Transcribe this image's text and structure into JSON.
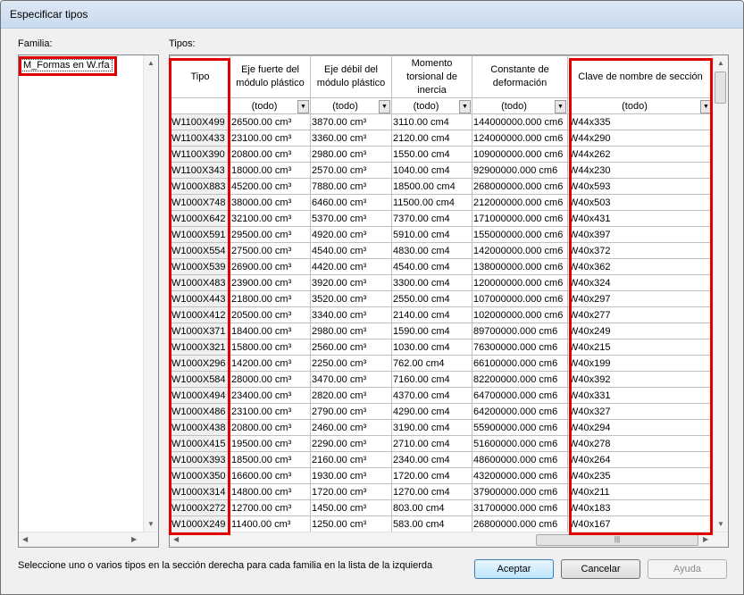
{
  "window_title": "Especificar tipos",
  "familia_label": "Familia:",
  "tipos_label": "Tipos:",
  "family_items": [
    "M_Formas en W.rfa"
  ],
  "columns": [
    "Tipo",
    "Eje fuerte del módulo plástico",
    "Eje débil del módulo plástico",
    "Momento torsional de inercia",
    "Constante de deformación",
    "Clave de nombre de sección"
  ],
  "filter_value": "(todo)",
  "rows": [
    [
      "W1100X499",
      "26500.00 cm³",
      "3870.00 cm³",
      "3110.00 cm4",
      "144000000.000 cm6",
      "W44x335"
    ],
    [
      "W1100X433",
      "23100.00 cm³",
      "3360.00 cm³",
      "2120.00 cm4",
      "124000000.000 cm6",
      "W44x290"
    ],
    [
      "W1100X390",
      "20800.00 cm³",
      "2980.00 cm³",
      "1550.00 cm4",
      "109000000.000 cm6",
      "W44x262"
    ],
    [
      "W1100X343",
      "18000.00 cm³",
      "2570.00 cm³",
      "1040.00 cm4",
      "92900000.000 cm6",
      "W44x230"
    ],
    [
      "W1000X883",
      "45200.00 cm³",
      "7880.00 cm³",
      "18500.00 cm4",
      "268000000.000 cm6",
      "W40x593"
    ],
    [
      "W1000X748",
      "38000.00 cm³",
      "6460.00 cm³",
      "11500.00 cm4",
      "212000000.000 cm6",
      "W40x503"
    ],
    [
      "W1000X642",
      "32100.00 cm³",
      "5370.00 cm³",
      "7370.00 cm4",
      "171000000.000 cm6",
      "W40x431"
    ],
    [
      "W1000X591",
      "29500.00 cm³",
      "4920.00 cm³",
      "5910.00 cm4",
      "155000000.000 cm6",
      "W40x397"
    ],
    [
      "W1000X554",
      "27500.00 cm³",
      "4540.00 cm³",
      "4830.00 cm4",
      "142000000.000 cm6",
      "W40x372"
    ],
    [
      "W1000X539",
      "26900.00 cm³",
      "4420.00 cm³",
      "4540.00 cm4",
      "138000000.000 cm6",
      "W40x362"
    ],
    [
      "W1000X483",
      "23900.00 cm³",
      "3920.00 cm³",
      "3300.00 cm4",
      "120000000.000 cm6",
      "W40x324"
    ],
    [
      "W1000X443",
      "21800.00 cm³",
      "3520.00 cm³",
      "2550.00 cm4",
      "107000000.000 cm6",
      "W40x297"
    ],
    [
      "W1000X412",
      "20500.00 cm³",
      "3340.00 cm³",
      "2140.00 cm4",
      "102000000.000 cm6",
      "W40x277"
    ],
    [
      "W1000X371",
      "18400.00 cm³",
      "2980.00 cm³",
      "1590.00 cm4",
      "89700000.000 cm6",
      "W40x249"
    ],
    [
      "W1000X321",
      "15800.00 cm³",
      "2560.00 cm³",
      "1030.00 cm4",
      "76300000.000 cm6",
      "W40x215"
    ],
    [
      "W1000X296",
      "14200.00 cm³",
      "2250.00 cm³",
      "762.00 cm4",
      "66100000.000 cm6",
      "W40x199"
    ],
    [
      "W1000X584",
      "28000.00 cm³",
      "3470.00 cm³",
      "7160.00 cm4",
      "82200000.000 cm6",
      "W40x392"
    ],
    [
      "W1000X494",
      "23400.00 cm³",
      "2820.00 cm³",
      "4370.00 cm4",
      "64700000.000 cm6",
      "W40x331"
    ],
    [
      "W1000X486",
      "23100.00 cm³",
      "2790.00 cm³",
      "4290.00 cm4",
      "64200000.000 cm6",
      "W40x327"
    ],
    [
      "W1000X438",
      "20800.00 cm³",
      "2460.00 cm³",
      "3190.00 cm4",
      "55900000.000 cm6",
      "W40x294"
    ],
    [
      "W1000X415",
      "19500.00 cm³",
      "2290.00 cm³",
      "2710.00 cm4",
      "51600000.000 cm6",
      "W40x278"
    ],
    [
      "W1000X393",
      "18500.00 cm³",
      "2160.00 cm³",
      "2340.00 cm4",
      "48600000.000 cm6",
      "W40x264"
    ],
    [
      "W1000X350",
      "16600.00 cm³",
      "1930.00 cm³",
      "1720.00 cm4",
      "43200000.000 cm6",
      "W40x235"
    ],
    [
      "W1000X314",
      "14800.00 cm³",
      "1720.00 cm³",
      "1270.00 cm4",
      "37900000.000 cm6",
      "W40x211"
    ],
    [
      "W1000X272",
      "12700.00 cm³",
      "1450.00 cm³",
      "803.00 cm4",
      "31700000.000 cm6",
      "W40x183"
    ],
    [
      "W1000X249",
      "11400.00 cm³",
      "1250.00 cm³",
      "583.00 cm4",
      "26800000.000 cm6",
      "W40x167"
    ]
  ],
  "status_text": "Seleccione uno o varios tipos en la sección derecha para cada familia en la lista de la izquierda",
  "buttons": {
    "ok": "Aceptar",
    "cancel": "Cancelar",
    "help": "Ayuda"
  },
  "colors": {
    "highlight": "#e00000",
    "primary_button": "#bee6fd"
  }
}
